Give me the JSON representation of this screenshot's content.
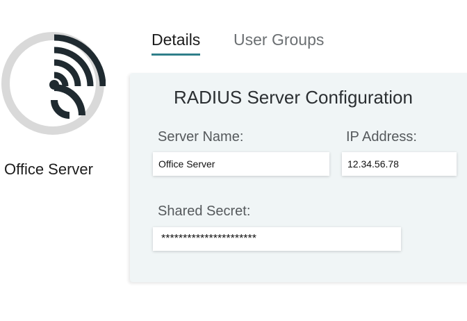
{
  "server": {
    "name": "Office Server",
    "icon": "wifi-signal-icon"
  },
  "tabs": [
    {
      "label": "Details",
      "active": true
    },
    {
      "label": "User Groups",
      "active": false
    }
  ],
  "panel": {
    "title": "RADIUS Server Configuration",
    "fields": {
      "server_name": {
        "label": "Server Name:",
        "value": "Office Server"
      },
      "ip_address": {
        "label": "IP Address:",
        "value": "12.34.56.78"
      },
      "shared_secret": {
        "label": "Shared Secret:",
        "value": "**********************"
      }
    }
  },
  "colors": {
    "accent": "#2f7f8a",
    "panel_background": "#f0f5f6",
    "icon_dark": "#1f2a30",
    "ring_gray": "#d9d9d9"
  }
}
